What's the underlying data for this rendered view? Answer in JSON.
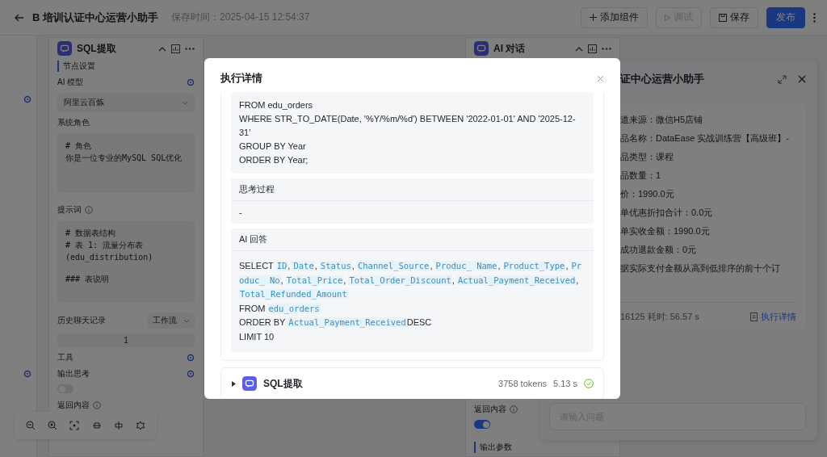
{
  "topbar": {
    "title": "B 培训认证中心运营小助手",
    "save_time": "保存时间：2025-04-15 12:54:37",
    "buttons": [
      {
        "label": "添加组件",
        "kind": "add",
        "disabled": false
      },
      {
        "label": "调试",
        "kind": "debug",
        "disabled": true
      },
      {
        "label": "保存",
        "kind": "save",
        "disabled": false
      },
      {
        "label": "发布",
        "kind": "publish",
        "disabled": false
      }
    ]
  },
  "sql_node": {
    "title": "SQL提取",
    "section": "节点设置",
    "model_label": "AI 模型",
    "model_value": "阿里云百炼",
    "system_role_label": "系统角色",
    "system_role_lines": [
      "# 角色",
      "你是一位专业的MySQL SQL优化"
    ],
    "prompt_label": "提示词",
    "prompt_lines": [
      "# 数据表结构",
      "# 表 1: 流量分布表",
      "(edu_distribution)",
      "### 表说明"
    ],
    "history_label": "历史聊天记录",
    "history_source": "工作流",
    "history_count": "1",
    "tools_label": "工具",
    "thinking_label": "输出思考",
    "thinking_on": false,
    "return_label": "返回内容"
  },
  "ai_node": {
    "title": "AI 对话",
    "return_label": "返回内容",
    "return_on": true,
    "output_label": "输出参数"
  },
  "chat_panel": {
    "title": "证中心运营小助手",
    "lines": [
      "道来源：微信H5店铺",
      "品名称：DataEase 实战训练营【高级班】-",
      "品类型：课程",
      "品数量：1",
      "价：1990.0元",
      "单优惠折扣合计：0.0元",
      "单实收金额：1990.0元",
      "成功退款金额：0元",
      "据实际支付金额从高到低排序的前十个订"
    ],
    "stats": "16125  耗时: 56.57 s",
    "details_link": "执行详情",
    "input_placeholder": "请输入问题"
  },
  "modal": {
    "title": "执行详情",
    "sql_lines": [
      "FROM edu_orders",
      "WHERE STR_TO_DATE(Date, '%Y/%m/%d') BETWEEN '2022-01-01' AND '2025-12-31'",
      "GROUP BY Year",
      "ORDER BY Year;"
    ],
    "thinking_title": "思考过程",
    "thinking_text": "-",
    "answer_title": "AI 回答",
    "answer_lines": [
      [
        {
          "kind": "keyword",
          "text": "SELECT"
        },
        {
          "kind": "identifier",
          "text": "ID"
        },
        {
          "kind": "punct",
          "text": ","
        },
        {
          "kind": "identifier",
          "text": "Date"
        },
        {
          "kind": "punct",
          "text": ","
        },
        {
          "kind": "identifier",
          "text": "Status"
        },
        {
          "kind": "punct",
          "text": ","
        },
        {
          "kind": "identifier",
          "text": "Channel_Source"
        },
        {
          "kind": "punct",
          "text": ","
        },
        {
          "kind": "identifier",
          "text": "Produc_ Name"
        },
        {
          "kind": "punct",
          "text": ","
        },
        {
          "kind": "identifier",
          "text": "Product_Type"
        },
        {
          "kind": "punct",
          "text": ","
        },
        {
          "kind": "identifier",
          "text": "Produc_ No"
        },
        {
          "kind": "punct",
          "text": ","
        },
        {
          "kind": "identifier",
          "text": "Total_Price"
        },
        {
          "kind": "punct",
          "text": ","
        },
        {
          "kind": "identifier",
          "text": "Total_Order_Discount"
        },
        {
          "kind": "punct",
          "text": ","
        },
        {
          "kind": "identifier",
          "text": "Actual_Payment_Received"
        },
        {
          "kind": "punct",
          "text": ","
        },
        {
          "kind": "identifier",
          "text": "Total_Refunded_Amount"
        }
      ],
      [
        {
          "kind": "keyword",
          "text": "FROM"
        },
        {
          "kind": "identifier",
          "text": "edu_orders"
        }
      ],
      [
        {
          "kind": "keyword",
          "text": "ORDER BY"
        },
        {
          "kind": "identifier",
          "text": "Actual_Payment_Received"
        },
        {
          "kind": "keyword",
          "text": "DESC"
        }
      ],
      [
        {
          "kind": "keyword",
          "text": "LIMIT 10"
        }
      ]
    ],
    "steps": [
      {
        "name": "SQL提取",
        "tokens": "3758 tokens",
        "time": "5.13 s",
        "completed": true,
        "expanded": false
      }
    ]
  }
}
